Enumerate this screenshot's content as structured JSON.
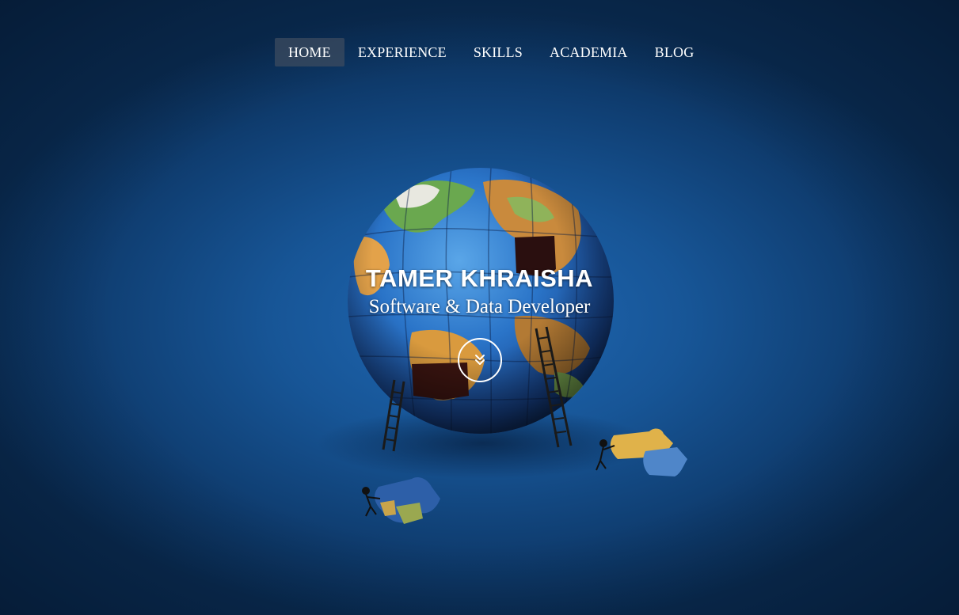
{
  "nav": {
    "items": [
      {
        "label": "HOME",
        "active": true
      },
      {
        "label": "EXPERIENCE",
        "active": false
      },
      {
        "label": "SKILLS",
        "active": false
      },
      {
        "label": "ACADEMIA",
        "active": false
      },
      {
        "label": "BLOG",
        "active": false
      }
    ]
  },
  "hero": {
    "title": "TAMER KHRAISHA",
    "subtitle": "Software & Data Developer",
    "scroll_icon": "double-chevron-down-icon"
  },
  "colors": {
    "background": "#175596",
    "nav_active_bg": "#3c4b5f",
    "text": "#ffffff"
  }
}
